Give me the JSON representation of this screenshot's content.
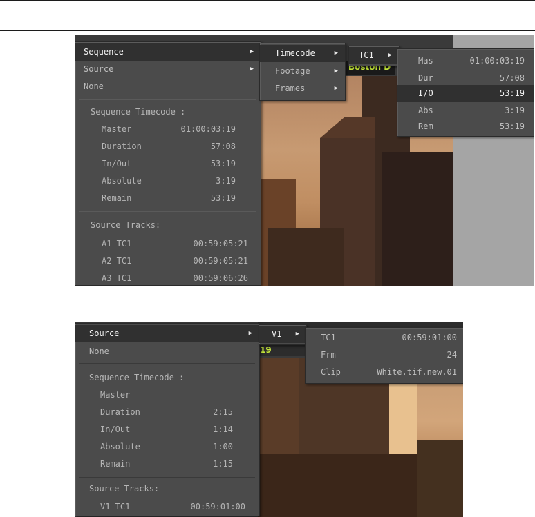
{
  "top": {
    "main_menu": {
      "items": [
        {
          "label": "Sequence",
          "has_submenu": true
        },
        {
          "label": "Source",
          "has_submenu": true
        },
        {
          "label": "None",
          "has_submenu": false
        }
      ],
      "seq_tc_header": "Sequence Timecode :",
      "seq_tc_rows": [
        {
          "label": "Master",
          "value": "01:00:03:19"
        },
        {
          "label": "Duration",
          "value": "57:08"
        },
        {
          "label": "In/Out",
          "value": "53:19"
        },
        {
          "label": "Absolute",
          "value": "3:19"
        },
        {
          "label": "Remain",
          "value": "53:19"
        }
      ],
      "src_header": "Source Tracks:",
      "src_rows": [
        {
          "label": "A1 TC1",
          "value": "00:59:05:21"
        },
        {
          "label": "A2 TC1",
          "value": "00:59:05:21"
        },
        {
          "label": "A3 TC1",
          "value": "00:59:06:26"
        }
      ]
    },
    "sub_menu": {
      "items": [
        {
          "label": "Timecode",
          "has_submenu": true
        },
        {
          "label": "Footage",
          "has_submenu": true
        },
        {
          "label": "Frames",
          "has_submenu": true
        }
      ]
    },
    "tc_menu": {
      "label": "TC1"
    },
    "values_menu": {
      "rows": [
        {
          "label": "Mas",
          "value": "01:00:03:19"
        },
        {
          "label": "Dur",
          "value": "57:08"
        },
        {
          "label": "I/O",
          "value": "53:19"
        },
        {
          "label": "Abs",
          "value": "3:19"
        },
        {
          "label": "Rem",
          "value": "53:19"
        }
      ]
    },
    "monitor_label": "Boston D"
  },
  "bottom": {
    "main_menu": {
      "items": [
        {
          "label": "Source",
          "has_submenu": true
        },
        {
          "label": "None",
          "has_submenu": false
        }
      ],
      "seq_tc_header": "Sequence Timecode :",
      "seq_tc_rows": [
        {
          "label": "Master",
          "value": ""
        },
        {
          "label": "Duration",
          "value": "2:15"
        },
        {
          "label": "In/Out",
          "value": "1:14"
        },
        {
          "label": "Absolute",
          "value": "1:00"
        },
        {
          "label": "Remain",
          "value": "1:15"
        }
      ],
      "src_header": "Source Tracks:",
      "src_rows": [
        {
          "label": "V1 TC1",
          "value": "00:59:01:00"
        }
      ]
    },
    "track_menu": {
      "label": "V1"
    },
    "info_menu": {
      "rows": [
        {
          "label": "TC1",
          "value": "00:59:01:00"
        },
        {
          "label": "Frm",
          "value": "24"
        },
        {
          "label": "Clip",
          "value": "White.tif.new.01"
        }
      ]
    },
    "monitor_label": "19"
  },
  "icons": {
    "submenu_arrow": "chevron-right-icon"
  },
  "colors": {
    "menu_bg": "#4b4b4b",
    "highlight": "#303030",
    "monitor_text": "#c6e83a"
  }
}
